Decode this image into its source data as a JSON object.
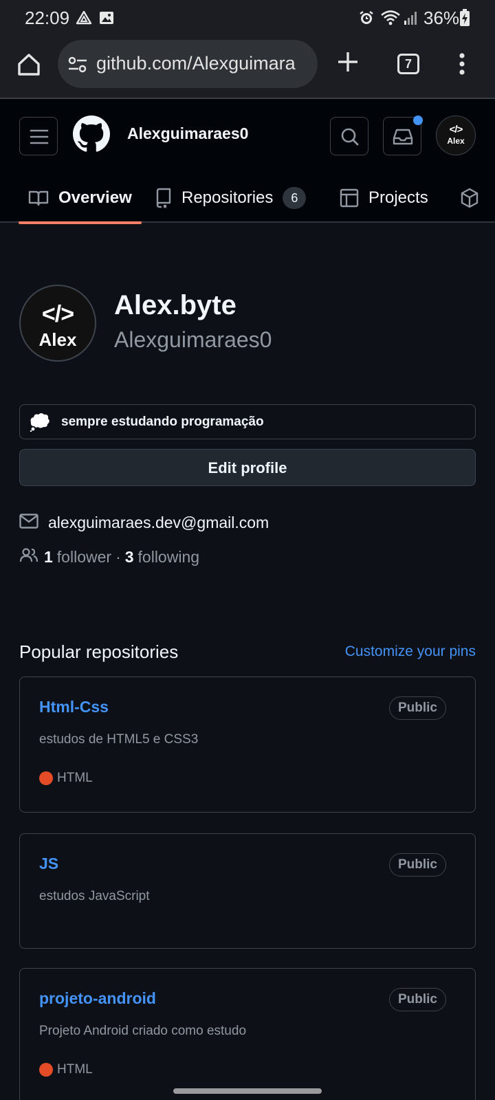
{
  "status_bar": {
    "time": "22:09",
    "battery": "36%"
  },
  "browser": {
    "url": "github.com/Alexguimara",
    "tab_count": "7"
  },
  "header": {
    "username": "Alexguimaraes0",
    "avatar_code": "</>",
    "avatar_name": "Alex"
  },
  "tabs": [
    {
      "label": "Overview"
    },
    {
      "label": "Repositories",
      "count": "6"
    },
    {
      "label": "Projects"
    }
  ],
  "profile": {
    "avatar_code": "</>",
    "avatar_name": "Alex",
    "display_name": "Alex.byte",
    "login": "Alexguimaraes0",
    "status": "sempre estudando programação",
    "edit_label": "Edit profile",
    "email": "alexguimaraes.dev@gmail.com",
    "followers": "1",
    "followers_label": "follower",
    "following": "3",
    "following_label": "following"
  },
  "popular": {
    "title": "Popular repositories",
    "customize_label": "Customize your pins",
    "repos": [
      {
        "name": "Html-Css",
        "visibility": "Public",
        "description": "estudos de HTML5 e CSS3",
        "language": "HTML",
        "language_color": "#e34c26"
      },
      {
        "name": "JS",
        "visibility": "Public",
        "description": "estudos JavaScript"
      },
      {
        "name": "projeto-android",
        "visibility": "Public",
        "description": "Projeto Android criado como estudo",
        "language": "HTML",
        "language_color": "#e34c26"
      }
    ]
  },
  "colors": {
    "accent": "#4493f8",
    "tab_underline": "#f78166",
    "background": "#0d1117"
  }
}
